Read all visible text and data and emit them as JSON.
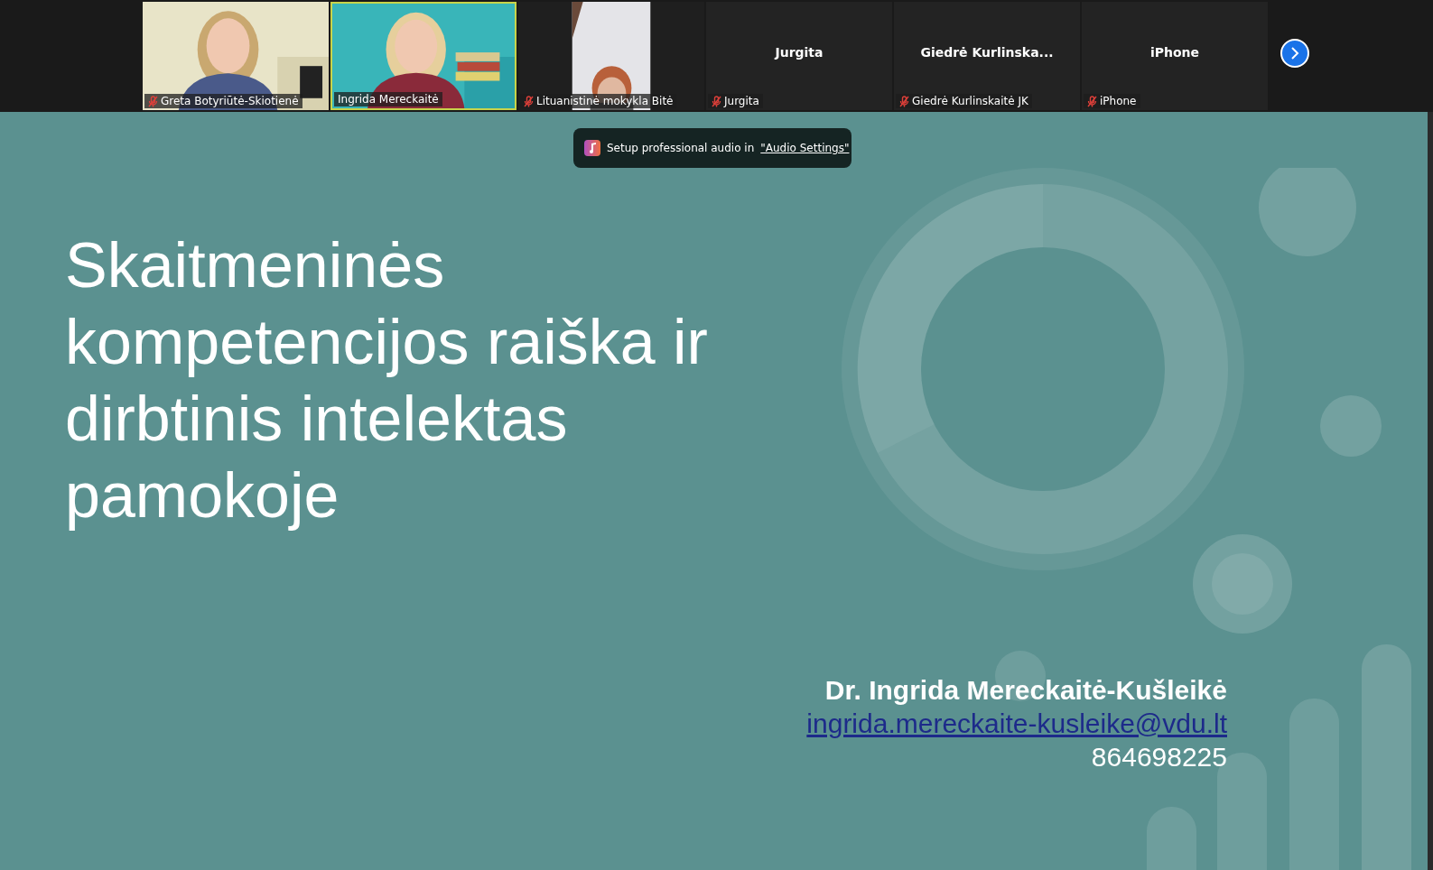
{
  "participants": [
    {
      "kind": "video",
      "name": "Greta Botyriūtė-Skiotienė",
      "muted": true,
      "speaking": false
    },
    {
      "kind": "video",
      "name": "Ingrida Mereckaitė",
      "muted": false,
      "speaking": true
    },
    {
      "kind": "video",
      "name": "Lituanistinė mokykla Bitė",
      "muted": true,
      "speaking": false
    },
    {
      "kind": "name",
      "display": "Jurgita",
      "name": "Jurgita",
      "muted": true,
      "speaking": false
    },
    {
      "kind": "name",
      "display": "Giedrė  Kurlinska...",
      "name": "Giedrė Kurlinskaitė JK",
      "muted": true,
      "speaking": false
    },
    {
      "kind": "name",
      "display": "iPhone",
      "name": "iPhone",
      "muted": true,
      "speaking": false
    }
  ],
  "notice": {
    "text": "Setup professional audio in",
    "link": "\"Audio Settings\""
  },
  "slide": {
    "title": "Skaitmeninės kompetencijos raiška ir dirbtinis intelektas pamokoje",
    "author": "Dr. Ingrida Mereckaitė-Kušleikė",
    "email": "ingrida.mereckaite-kusleike@vdu.lt",
    "phone": "864698225"
  }
}
